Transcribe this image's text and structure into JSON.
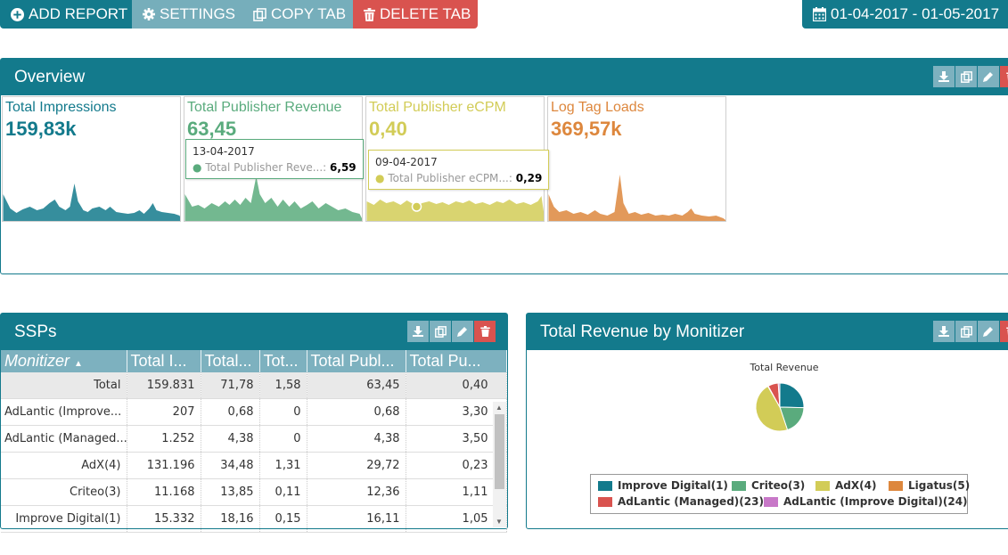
{
  "toolbar": {
    "add_report": "ADD REPORT",
    "settings": "SETTINGS",
    "copy_tab": "COPY TAB",
    "delete_tab": "DELETE TAB",
    "date_range": "01-04-2017 - 01-05-2017"
  },
  "overview": {
    "title": "Overview",
    "stats": [
      {
        "label": "Total Impressions",
        "value": "159,83k",
        "color": "#137a8c"
      },
      {
        "label": "Total Publisher Revenue",
        "value": "63,45",
        "color": "#5aab7d"
      },
      {
        "label": "Total Publisher eCPM",
        "value": "0,40",
        "color": "#d2cc57"
      },
      {
        "label": "Log Tag Loads",
        "value": "369,57k",
        "color": "#dd873d"
      }
    ],
    "tooltips": [
      {
        "date": "13-04-2017",
        "name": "Total Publisher Reve...:",
        "value": "6,59"
      },
      {
        "date": "09-04-2017",
        "name": "Total Publisher eCPM...:",
        "value": "0,29"
      }
    ]
  },
  "ssps": {
    "title": "SSPs",
    "columns": [
      "Monitizer",
      "Total I...",
      "Total...",
      "Tot...",
      "Total Publ...",
      "Total Pu..."
    ],
    "total_row": [
      "Total",
      "159.831",
      "71,78",
      "1,58",
      "63,45",
      "0,40"
    ],
    "rows": [
      [
        "AdLantic (Improve...",
        "207",
        "0,68",
        "0",
        "0,68",
        "3,30"
      ],
      [
        "AdLantic (Managed...",
        "1.252",
        "4,38",
        "0",
        "4,38",
        "3,50"
      ],
      [
        "AdX(4)",
        "131.196",
        "34,48",
        "1,31",
        "29,72",
        "0,23"
      ],
      [
        "Criteo(3)",
        "11.168",
        "13,85",
        "0,11",
        "12,36",
        "1,11"
      ],
      [
        "Improve Digital(1)",
        "15.332",
        "18,16",
        "0,15",
        "16,11",
        "1,05"
      ]
    ]
  },
  "revenue": {
    "title": "Total Revenue by Monitizer",
    "chart_data": {
      "type": "pie",
      "title": "Total Revenue",
      "slices": [
        {
          "name": "Improve Digital(1)",
          "value": 16.11,
          "color": "#137a8c"
        },
        {
          "name": "Criteo(3)",
          "value": 12.36,
          "color": "#5aab7d"
        },
        {
          "name": "AdX(4)",
          "value": 29.72,
          "color": "#d2cc57"
        },
        {
          "name": "Ligatus(5)",
          "value": 0.2,
          "color": "#dd873d"
        },
        {
          "name": "AdLantic (Managed)(23)",
          "value": 4.38,
          "color": "#d9534f"
        },
        {
          "name": "AdLantic (Improve Digital)(24)",
          "value": 0.68,
          "color": "#c878c8"
        }
      ],
      "legend_position": "bottom"
    }
  },
  "icons": {
    "add": "plus-circle-icon",
    "settings": "gear-icon",
    "copy": "copy-icon",
    "delete": "trash-icon",
    "calendar": "calendar-icon",
    "download": "download-icon",
    "edit": "pencil-icon"
  }
}
